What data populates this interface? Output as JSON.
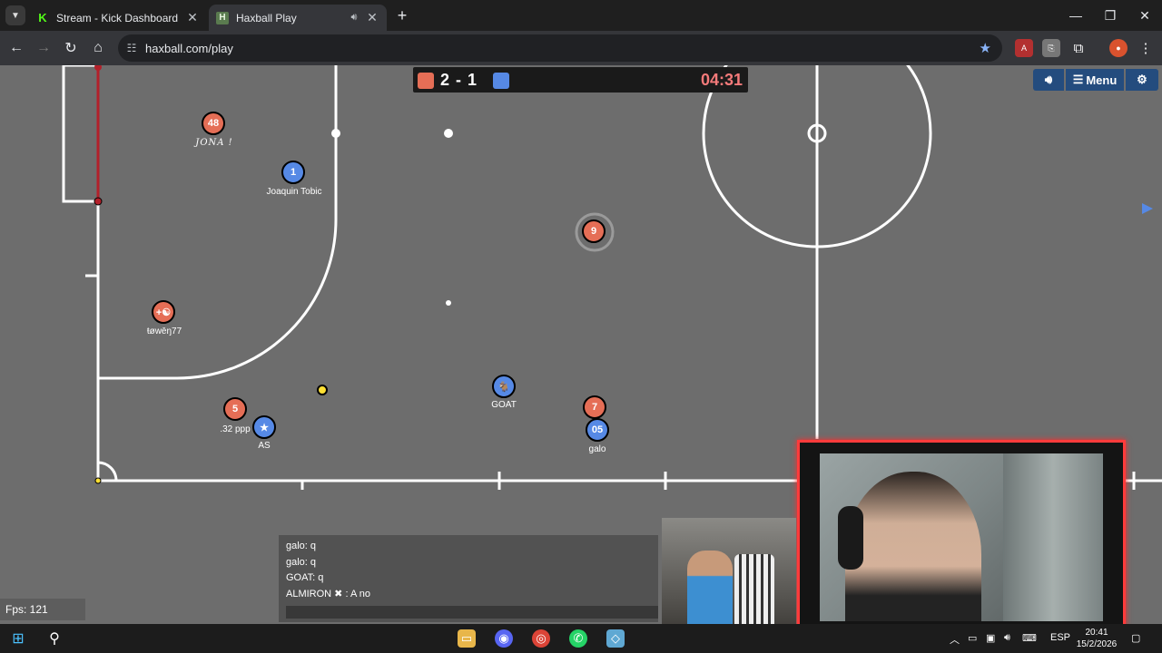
{
  "browser": {
    "tabs": [
      {
        "title": "Stream - Kick Dashboard",
        "icon": "kick-icon",
        "active": false
      },
      {
        "title": "Haxball Play",
        "icon": "haxball-icon",
        "active": true
      }
    ],
    "url": "haxball.com/play"
  },
  "game": {
    "score": "2 - 1",
    "timer": "04:31",
    "menu_label": "Menu",
    "players": [
      {
        "team": "red",
        "number": "48",
        "name": "JONA !"
      },
      {
        "team": "blue",
        "number": "1",
        "name": "Joaquin Tobic"
      },
      {
        "team": "red",
        "number": "9",
        "name": ""
      },
      {
        "team": "red",
        "number": "+☯",
        "name": "ŧøwēŋ77"
      },
      {
        "team": "red",
        "number": "5",
        "name": ".32 ppp"
      },
      {
        "team": "blue",
        "number": "★",
        "name": "AS"
      },
      {
        "team": "blue",
        "number": "🐐",
        "name": "GOAT"
      },
      {
        "team": "red",
        "number": "7",
        "name": ""
      },
      {
        "team": "blue",
        "number": "05",
        "name": "galo"
      }
    ],
    "chat": [
      {
        "text": "galo: q"
      },
      {
        "text": "galo: q"
      },
      {
        "text": "GOAT: q"
      },
      {
        "text": "ALMIRON ✖ : A no"
      }
    ],
    "fps": "Fps: 121"
  },
  "taskbar": {
    "language": "ESP",
    "time": "20:41",
    "date": "15/2/2026"
  },
  "colors": {
    "red_team": "#e56e56",
    "blue_team": "#5689e5",
    "field": "#6d6d6d",
    "timer": "#f47a7a"
  }
}
